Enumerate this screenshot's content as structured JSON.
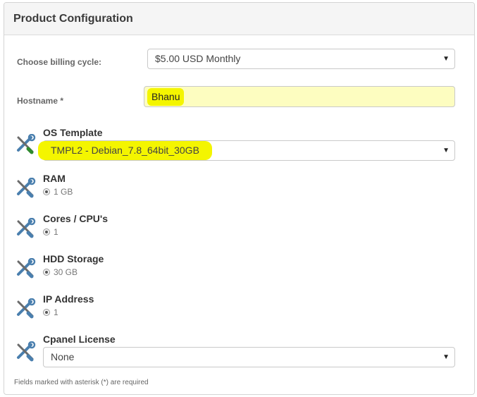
{
  "panel": {
    "title": "Product Configuration"
  },
  "billing": {
    "label": "Choose billing cycle:",
    "value": "$5.00 USD Monthly"
  },
  "hostname": {
    "label": "Hostname *",
    "value": "Bhanu"
  },
  "options": [
    {
      "label": "OS Template",
      "type": "select",
      "value": "TMPL2 - Debian_7.8_64bit_30GB",
      "highlight_color": "#f4f500"
    },
    {
      "label": "RAM",
      "type": "radio",
      "value": "1 GB"
    },
    {
      "label": "Cores / CPU's",
      "type": "radio",
      "value": "1"
    },
    {
      "label": "HDD Storage",
      "type": "radio",
      "value": "30 GB"
    },
    {
      "label": "IP Address",
      "type": "radio",
      "value": "1"
    },
    {
      "label": "Cpanel License",
      "type": "select",
      "value": "None"
    }
  ],
  "footnote": "Fields marked with asterisk (*) are required",
  "colors": {
    "highlight": "#f4f500",
    "input_bg": "#fdfdc0",
    "header_bg": "#f5f5f5",
    "wrench_icon": "#5a8db8"
  }
}
